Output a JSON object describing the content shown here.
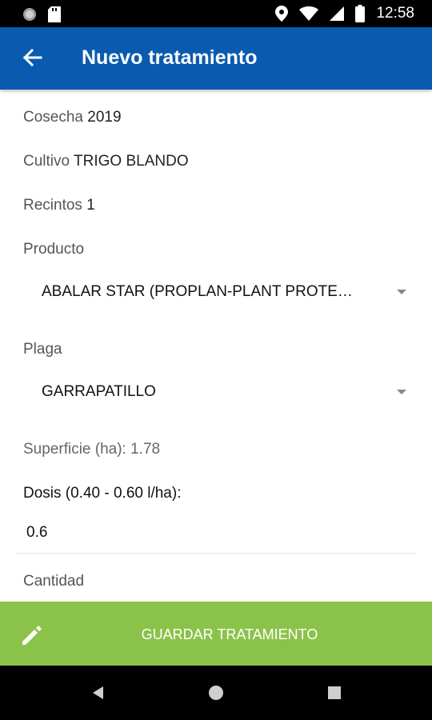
{
  "status_bar": {
    "time": "12:58"
  },
  "app_bar": {
    "title": "Nuevo tratamiento"
  },
  "form": {
    "cosecha": {
      "label": "Cosecha",
      "value": "2019"
    },
    "cultivo": {
      "label": "Cultivo",
      "value": "TRIGO BLANDO"
    },
    "recintos": {
      "label": "Recintos",
      "value": "1"
    },
    "producto": {
      "label": "Producto",
      "selected": "ABALAR STAR (PROPLAN-PLANT PROTE…"
    },
    "plaga": {
      "label": "Plaga",
      "selected": "GARRAPATILLO"
    },
    "superficie": "Superficie (ha): 1.78",
    "dosis": {
      "label": "Dosis (0.40 - 0.60 l/ha):",
      "value": "0.6"
    },
    "cantidad": {
      "label": "Cantidad"
    }
  },
  "save_button": {
    "label": "GUARDAR TRATAMIENTO"
  },
  "colors": {
    "app_bar": "#0a5bb0",
    "save_bar": "#8bc34a"
  }
}
